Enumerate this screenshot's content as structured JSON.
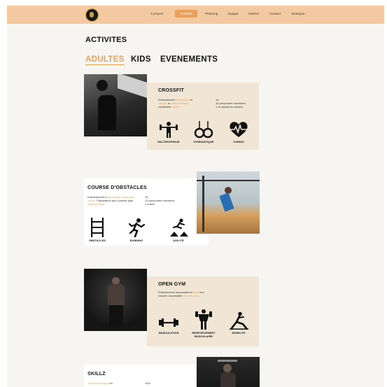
{
  "nav": {
    "items": [
      "A propos",
      "Activités",
      "Planning",
      "Equipe",
      "Galerie",
      "Contact",
      "Boutique"
    ],
    "active_index": 1
  },
  "page": {
    "title": "ACTIVITES"
  },
  "tabs": [
    {
      "label": "ADULTES",
      "active": true
    },
    {
      "label": "KIDS",
      "active": false
    },
    {
      "label": "EVENEMENTS",
      "active": false
    }
  ],
  "activities": [
    {
      "title": "CROSSFIT",
      "description": [
        "Entraînement ",
        "fonctionnel",
        " et ",
        "coaché",
        " à ",
        "haute intensité",
        " combinant ",
        "cardio"
      ],
      "meta": [
        "1h",
        "16 personnes maximum",
        "1 ou plusieurs coachs"
      ],
      "features": [
        {
          "icon": "weightlifting-icon",
          "label": "HALTEROPHILIE"
        },
        {
          "icon": "gymnastic-rings-icon",
          "label": "GYMNASTIQUE"
        },
        {
          "icon": "cardio-heart-icon",
          "label": "CARDIO"
        }
      ]
    },
    {
      "title": "COURSE D'OBSTACLES",
      "description": [
        "Entraînement à ",
        "dominante",
        " ",
        "endurance",
        " ",
        "cardio",
        ". Préparation aux courses type ",
        "Spartan Race",
        "."
      ],
      "meta": [
        "1h",
        "12 personnes maximum",
        "1 coach"
      ],
      "features": [
        {
          "icon": "obstacle-ladder-icon",
          "label": "OBSTACLES"
        },
        {
          "icon": "running-icon",
          "label": "RUNNING"
        },
        {
          "icon": "agility-jump-icon",
          "label": "AGILITE"
        }
      ]
    },
    {
      "title": "OPEN GYM",
      "description": [
        "Entraînement accessible en ",
        "libre",
        " non coaché. Accessible ",
        "tous les jours",
        "."
      ],
      "meta": [],
      "features": [
        {
          "icon": "dumbbell-icon",
          "label": "MUSCULATION"
        },
        {
          "icon": "muscle-man-icon",
          "label": "RENFORCEMENT MUSCULAIRE"
        },
        {
          "icon": "stretching-icon",
          "label": "MOBILITE"
        }
      ]
    },
    {
      "title": "SKILLZ",
      "description": [
        "Travail technique",
        " en"
      ],
      "meta": [
        "1/2h"
      ],
      "features": []
    }
  ],
  "colors": {
    "accent": "#e8a15a",
    "nav_bg": "#f2c9a0",
    "card_beige": "#f1e6d5",
    "page_bg": "#f7f5f2"
  }
}
